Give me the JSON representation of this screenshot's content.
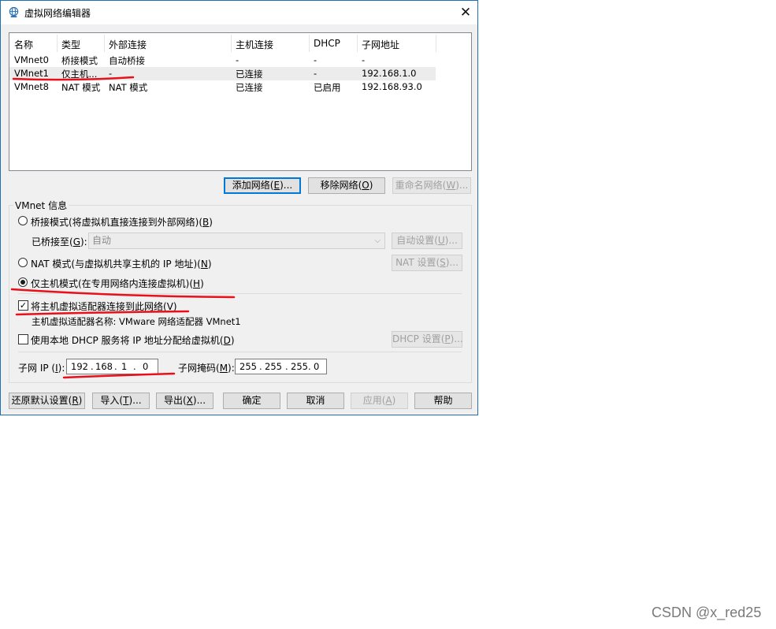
{
  "window": {
    "title": "虚拟网络编辑器"
  },
  "table": {
    "columns": [
      "名称",
      "类型",
      "外部连接",
      "主机连接",
      "DHCP",
      "子网地址"
    ],
    "rows": [
      [
        "VMnet0",
        "桥接模式",
        "自动桥接",
        "-",
        "-",
        "-"
      ],
      [
        "VMnet1",
        "仅主机...",
        "-",
        "已连接",
        "-",
        "192.168.1.0"
      ],
      [
        "VMnet8",
        "NAT 模式",
        "NAT 模式",
        "已连接",
        "已启用",
        "192.168.93.0"
      ]
    ],
    "selected_row": 1
  },
  "list_buttons": {
    "add": {
      "text": "添加网络(",
      "key": "E",
      "tail": ")..."
    },
    "remove": {
      "text": "移除网络(",
      "key": "O",
      "tail": ")"
    },
    "rename": {
      "text": "重命名网络(",
      "key": "W",
      "tail": ")..."
    }
  },
  "vmnet_info": {
    "group_label": "VMnet 信息",
    "bridge_mode": {
      "text": "桥接模式(将虚拟机直接连接到外部网络)(",
      "key": "B",
      "tail": ")"
    },
    "bridged_to": {
      "text": "已桥接至(",
      "key": "G",
      "tail": "):"
    },
    "bridged_to_value": "自动",
    "auto_settings": {
      "text": "自动设置(",
      "key": "U",
      "tail": ")..."
    },
    "nat_mode": {
      "text": "NAT 模式(与虚拟机共享主机的 IP 地址)(",
      "key": "N",
      "tail": ")"
    },
    "nat_settings": {
      "text": "NAT 设置(",
      "key": "S",
      "tail": ")..."
    },
    "host_only": {
      "text": "仅主机模式(在专用网络内连接虚拟机)(",
      "key": "H",
      "tail": ")"
    },
    "connect_adapter": {
      "text": "将主机虚拟适配器连接到此网络(",
      "key": "V",
      "tail": ")"
    },
    "adapter_name": "主机虚拟适配器名称: VMware 网络适配器 VMnet1",
    "use_dhcp": {
      "text": "使用本地 DHCP 服务将 IP 地址分配给虚拟机(",
      "key": "D",
      "tail": ")"
    },
    "dhcp_settings": {
      "text": "DHCP 设置(",
      "key": "P",
      "tail": ")..."
    },
    "subnet_ip_label": {
      "text": "子网 IP (",
      "key": "I",
      "tail": "):"
    },
    "subnet_ip": [
      "192",
      "168",
      "1",
      "0"
    ],
    "subnet_mask_label": {
      "text": "子网掩码(",
      "key": "M",
      "tail": "):"
    },
    "subnet_mask": [
      "255",
      "255",
      "255",
      "0"
    ]
  },
  "footer": {
    "restore": {
      "text": "还原默认设置(",
      "key": "R",
      "tail": ")"
    },
    "import": {
      "text": "导入(",
      "key": "T",
      "tail": ")..."
    },
    "export": {
      "text": "导出(",
      "key": "X",
      "tail": ")..."
    },
    "ok": "确定",
    "cancel": "取消",
    "apply": {
      "text": "应用(",
      "key": "A",
      "tail": ")"
    },
    "help": "帮助"
  },
  "colors": {
    "annotation_red": "#e8101a",
    "accent": "#0078d7"
  },
  "watermark": "CSDN @x_red25"
}
